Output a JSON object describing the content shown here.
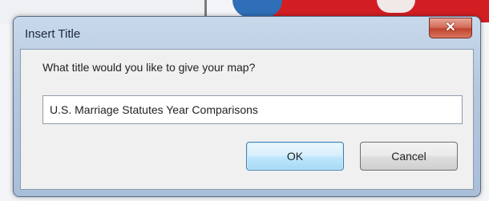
{
  "dialog": {
    "title": "Insert Title",
    "close_glyph": "✕",
    "prompt": "What title would you like to give your map?",
    "input_value": "U.S. Marriage Statutes Year Comparisons",
    "ok_label": "OK",
    "cancel_label": "Cancel"
  },
  "colors": {
    "map_red": "#d21e23",
    "map_blue": "#2f6fb8",
    "close_button": "#c0442e",
    "ok_button_border": "#3c7fb1"
  },
  "icons": {
    "close": "close-icon"
  }
}
